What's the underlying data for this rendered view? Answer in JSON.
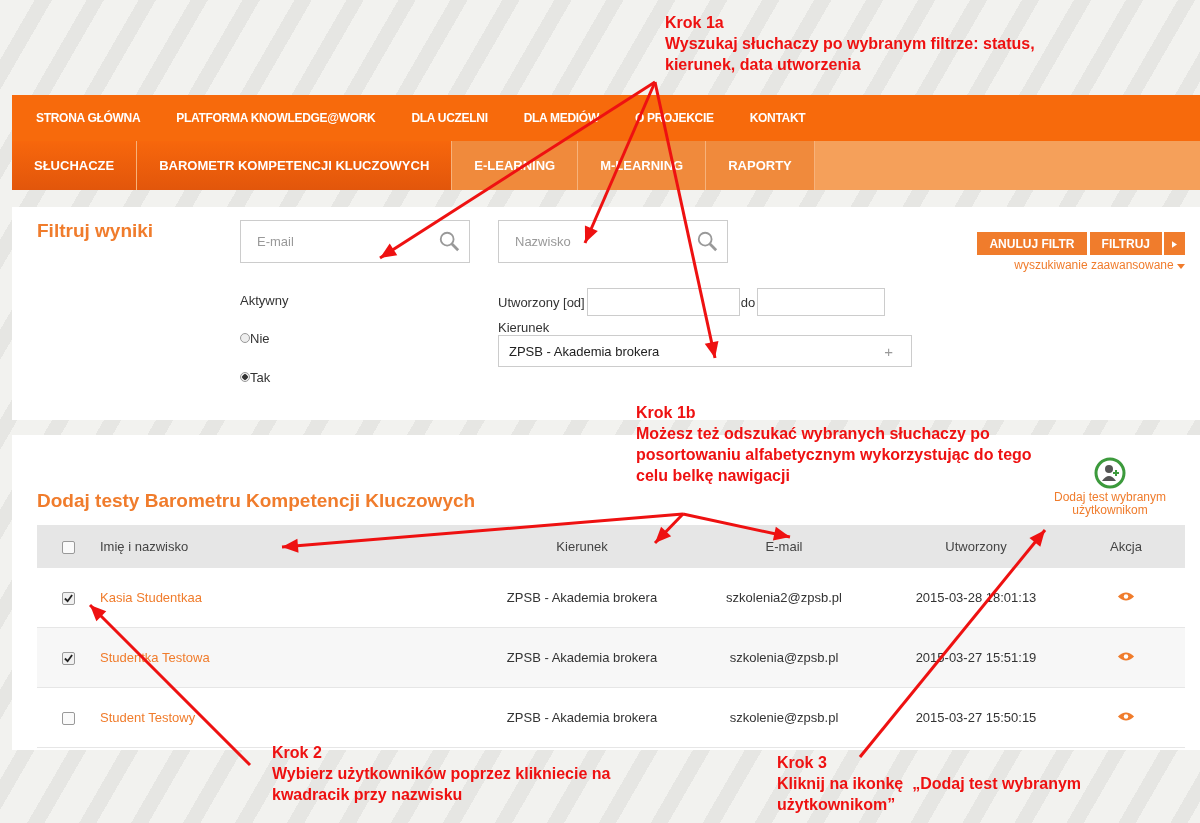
{
  "annotations": [
    {
      "step": "Krok 1a",
      "text": "Wyszukaj słuchaczy po wybranym filtrze: status, kierunek, data utworzenia"
    },
    {
      "step": "Krok 1b",
      "text": "Możesz też odszukać wybranych słuchaczy po posortowaniu alfabetycznym wykorzystując do tego celu belkę nawigacji"
    },
    {
      "step": "Krok 2",
      "text": "Wybierz użytkowników poprzez klikniecie na kwadracik przy nazwisku"
    },
    {
      "step": "Krok 3",
      "text": "Kliknij na ikonkę  „Dodaj test wybranym użytkownikom”"
    }
  ],
  "main_menu": [
    "STRONA GŁÓWNA",
    "PLATFORMA KNOWLEDGE@WORK",
    "DLA UCZELNI",
    "DLA MEDIÓW",
    "O PROJEKCIE",
    "KONTAKT"
  ],
  "sub_menu": [
    {
      "label": "SŁUCHACZE",
      "selected": true
    },
    {
      "label": "BAROMETR KOMPETENCJI KLUCZOWYCH",
      "selected": true
    },
    {
      "label": "E-LEARNING",
      "selected": false
    },
    {
      "label": "M-LEARNING",
      "selected": false
    },
    {
      "label": "RAPORTY",
      "selected": false
    }
  ],
  "filter": {
    "title": "Filtruj wyniki",
    "email_placeholder": "E-mail",
    "surname_placeholder": "Nazwisko",
    "active_label": "Aktywny",
    "active_options": [
      {
        "label": "Nie",
        "selected": false
      },
      {
        "label": "Tak",
        "selected": true
      }
    ],
    "created_from_label": "Utworzony [od]",
    "created_to_label": "do",
    "direction_label": "Kierunek",
    "direction_value": "ZPSB - Akademia brokera",
    "direction_add": "+",
    "cancel_button": "ANULUJ FILTR",
    "filter_button": "FILTRUJ",
    "advanced_link": "wyszukiwanie zaawansowane"
  },
  "table": {
    "title": "Dodaj testy Barometru Kompetencji Kluczowych",
    "add_action": "Dodaj test wybranym użytkownikom",
    "select_all_checked": false,
    "columns": [
      "Imię i nazwisko",
      "Kierunek",
      "E-mail",
      "Utworzony",
      "Akcja"
    ],
    "rows": [
      {
        "checked": true,
        "name": "Kasia Studentkaa",
        "direction": "ZPSB - Akademia brokera",
        "email": "szkolenia2@zpsb.pl",
        "created": "2015-03-28 18:01:13"
      },
      {
        "checked": true,
        "name": "Studentka Testowa",
        "direction": "ZPSB - Akademia brokera",
        "email": "szkolenia@zpsb.pl",
        "created": "2015-03-27 15:51:19"
      },
      {
        "checked": false,
        "name": "Student Testowy",
        "direction": "ZPSB - Akademia brokera",
        "email": "szkolenie@zpsb.pl",
        "created": "2015-03-27 15:50:15"
      }
    ]
  }
}
